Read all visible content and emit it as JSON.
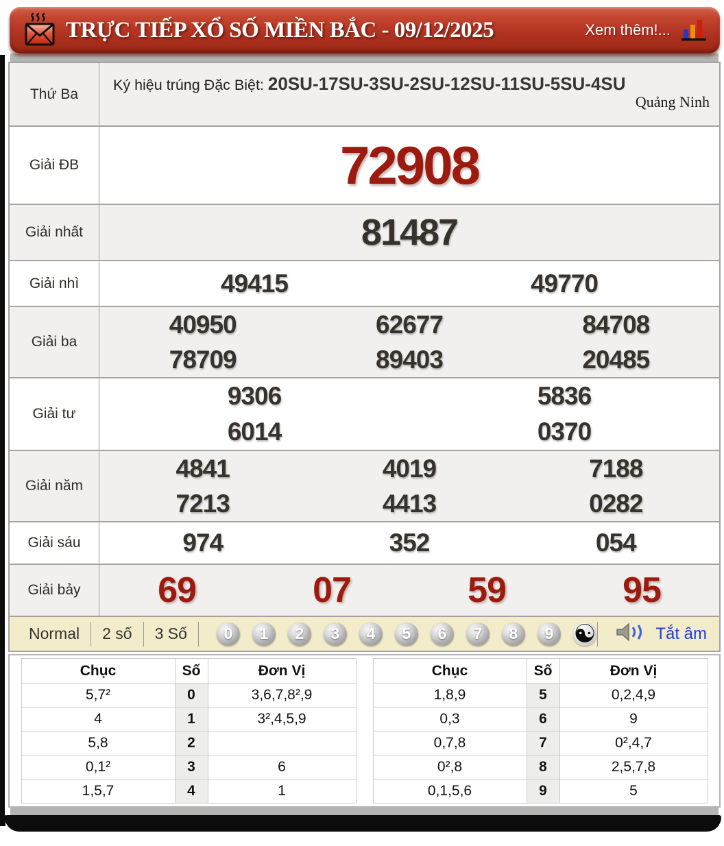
{
  "header": {
    "title": "TRỰC TIẾP XỔ SỐ MIỀN BẮC - 09/12/2025",
    "more_link": "Xem thêm!..."
  },
  "draw": {
    "day_label": "Thứ Ba",
    "sign_prefix": "Ký hiệu trúng Đặc Biệt:",
    "sign_codes": "20SU-17SU-3SU-2SU-12SU-11SU-5SU-4SU",
    "province": "Quảng Ninh"
  },
  "prizes": {
    "db": {
      "label": "Giải ĐB",
      "numbers": [
        "72908"
      ]
    },
    "nhat": {
      "label": "Giải nhất",
      "numbers": [
        "81487"
      ]
    },
    "nhi": {
      "label": "Giải nhì",
      "numbers": [
        "49415",
        "49770"
      ]
    },
    "ba": {
      "label": "Giải ba",
      "numbers": [
        "40950",
        "62677",
        "84708",
        "78709",
        "89403",
        "20485"
      ]
    },
    "tu": {
      "label": "Giải tư",
      "numbers": [
        "9306",
        "5836",
        "6014",
        "0370"
      ]
    },
    "nam": {
      "label": "Giải năm",
      "numbers": [
        "4841",
        "4019",
        "7188",
        "7213",
        "4413",
        "0282"
      ]
    },
    "sau": {
      "label": "Giải sáu",
      "numbers": [
        "974",
        "352",
        "054"
      ]
    },
    "bay": {
      "label": "Giải bảy",
      "numbers": [
        "69",
        "07",
        "59",
        "95"
      ]
    }
  },
  "controls": {
    "modes": [
      "Normal",
      "2 số",
      "3 Số"
    ],
    "balls": [
      "0",
      "1",
      "2",
      "3",
      "4",
      "5",
      "6",
      "7",
      "8",
      "9"
    ],
    "yinyang_glyph": "☯",
    "mute_label": "Tắt âm"
  },
  "digit_summary": {
    "headers": [
      "Chục",
      "Số",
      "Đơn Vị"
    ],
    "left_rows": [
      [
        "5,7²",
        "0",
        "3,6,7,8²,9"
      ],
      [
        "4",
        "1",
        "3²,4,5,9"
      ],
      [
        "5,8",
        "2",
        ""
      ],
      [
        "0,1²",
        "3",
        "6"
      ],
      [
        "1,5,7",
        "4",
        "1"
      ]
    ],
    "right_rows": [
      [
        "1,8,9",
        "5",
        "0,2,4,9"
      ],
      [
        "0,3",
        "6",
        "9"
      ],
      [
        "0,7,8",
        "7",
        "0²,4,7"
      ],
      [
        "0²,8",
        "8",
        "2,5,7,8"
      ],
      [
        "0,1,5,6",
        "9",
        "5"
      ]
    ]
  },
  "colors": {
    "header_red": "#b23322",
    "prize_red": "#9d1a0e",
    "number_dark": "#37332c",
    "control_beige": "#f3ecca",
    "mute_blue": "#1c3ddb",
    "frame_black": "#0c0c0c"
  }
}
